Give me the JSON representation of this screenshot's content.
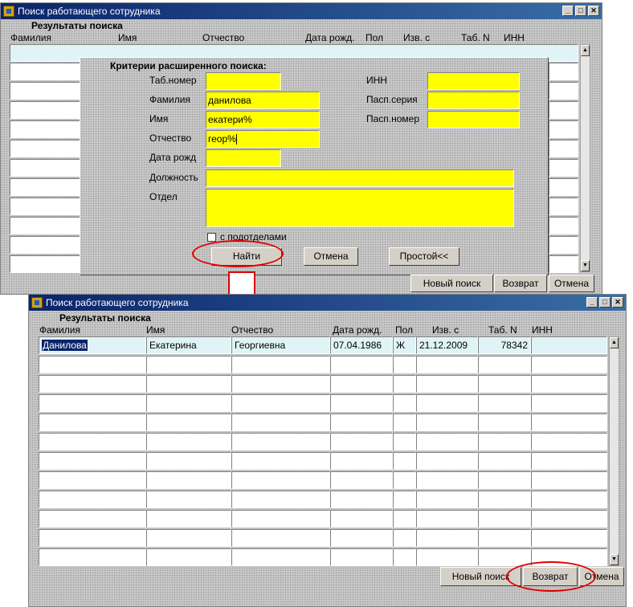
{
  "window1": {
    "title": "Поиск работающего сотрудника",
    "section_title": "Результаты поиска",
    "columns": [
      "Фамилия",
      "Имя",
      "Отчество",
      "Дата рожд.",
      "Пол",
      "Изв. с",
      "Таб. N",
      "ИНН"
    ],
    "buttons": {
      "new_search": "Новый поиск",
      "return": "Возврат",
      "cancel": "Отмена"
    }
  },
  "criteria": {
    "title": "Критерии расширенного поиска:",
    "labels": {
      "tab_number": "Таб.номер",
      "surname": "Фамилия",
      "name": "Имя",
      "patronymic": "Отчество",
      "birth_date": "Дата рожд",
      "position": "Должность",
      "department": "Отдел",
      "inn": "ИНН",
      "passport_series": "Пасп.серия",
      "passport_number": "Пасп.номер"
    },
    "values": {
      "tab_number": "",
      "surname": "данилова",
      "name": "екатери%",
      "patronymic": "геор%",
      "birth_date": "",
      "position": "",
      "department": "",
      "inn": "",
      "passport_series": "",
      "passport_number": ""
    },
    "subdepartments_label": "с подотделами",
    "subdepartments_checked": false,
    "buttons": {
      "find": "Найти",
      "cancel": "Отмена",
      "simple": "Простой<<"
    }
  },
  "window2": {
    "title": "Поиск работающего сотрудника",
    "section_title": "Результаты поиска",
    "columns": [
      "Фамилия",
      "Имя",
      "Отчество",
      "Дата рожд.",
      "Пол",
      "Изв. с",
      "Таб. N",
      "ИНН"
    ],
    "rows": [
      {
        "surname": "Данилова",
        "name": "Екатерина",
        "patronymic": "Георгиевна",
        "birth_date": "07.04.1986",
        "sex": "Ж",
        "since": "21.12.2009",
        "tab_number": "78342",
        "inn": ""
      }
    ],
    "buttons": {
      "new_search": "Новый поиск",
      "return": "Возврат",
      "cancel": "Отмена"
    }
  },
  "colors": {
    "field_highlight": "#ffff00",
    "current_row": "#e0f4f8",
    "title_bar": "#0a246a",
    "annotation": "#e00000"
  }
}
